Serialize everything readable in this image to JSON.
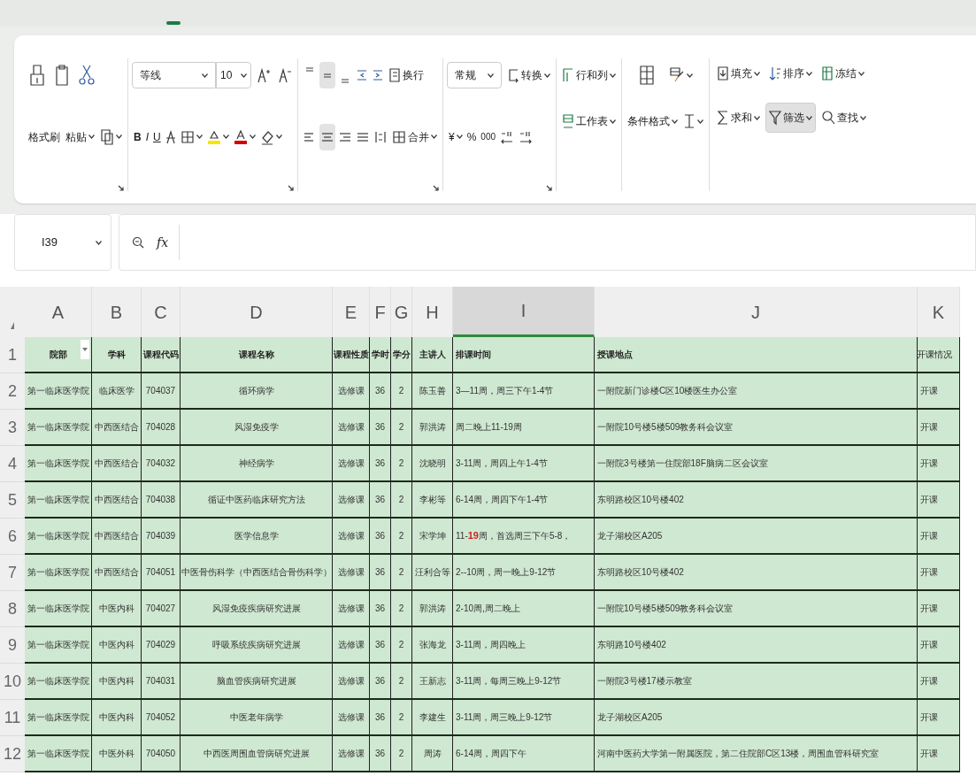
{
  "ribbon": {
    "clipboard": {
      "format_painter": "格式刷",
      "paste": "粘贴"
    },
    "font": {
      "name": "等线",
      "size": "10",
      "styles": [
        "B",
        "I",
        "U"
      ]
    },
    "alignment": {
      "vertical": [
        {
          "selected": false
        },
        {
          "selected": true
        },
        {
          "selected": false
        }
      ],
      "horizontal": [
        {
          "selected": false
        },
        {
          "selected": true
        },
        {
          "selected": false
        },
        {
          "selected": false
        }
      ],
      "wrap": "换行",
      "merge": "合并"
    },
    "number": {
      "format": "常规",
      "convert": "转换",
      "currency": "¥",
      "percent": "%",
      "thousands": "000"
    },
    "cells": {
      "rows_cols": "行和列",
      "sheet": "工作表",
      "cond_format": "条件格式"
    },
    "editing": [
      {
        "label": "填充",
        "pressed": false
      },
      {
        "label": "排序",
        "pressed": false
      },
      {
        "label": "冻结",
        "pressed": false
      },
      {
        "label": "求和",
        "pressed": false
      },
      {
        "label": "筛选",
        "pressed": true
      },
      {
        "label": "查找",
        "pressed": false
      }
    ]
  },
  "formula_bar": {
    "name_box": "I39",
    "function_button": "fx"
  },
  "columns": [
    {
      "letter": "A",
      "selected": false,
      "filter": true
    },
    {
      "letter": "B",
      "selected": false,
      "filter": false
    },
    {
      "letter": "C",
      "selected": false,
      "filter": false
    },
    {
      "letter": "D",
      "selected": false,
      "filter": false
    },
    {
      "letter": "E",
      "selected": false,
      "filter": false
    },
    {
      "letter": "F",
      "selected": false,
      "filter": false
    },
    {
      "letter": "G",
      "selected": false,
      "filter": false
    },
    {
      "letter": "H",
      "selected": false,
      "filter": false
    },
    {
      "letter": "I",
      "selected": true,
      "filter": false
    },
    {
      "letter": "J",
      "selected": false,
      "filter": false
    },
    {
      "letter": "K",
      "selected": false,
      "filter": false
    }
  ],
  "header_row": {
    "number": "1",
    "cells": [
      "院部",
      "学科",
      "课程代码",
      "课程名称",
      "课程性质",
      "学时",
      "学分",
      "主讲人",
      "排课时间",
      "授课地点",
      "开课情况"
    ]
  },
  "rows": [
    {
      "number": "2",
      "cells": [
        "第一临床医学院",
        "临床医学",
        "704037",
        "循环病学",
        "选修课",
        "36",
        "2",
        "陈玉善",
        [
          {
            "text": "3—11周，周三下午1-4节"
          }
        ],
        "一附院新门诊楼C区10楼医生办公室",
        "开课"
      ]
    },
    {
      "number": "3",
      "cells": [
        "第一临床医学院",
        "中西医结合",
        "704028",
        "风湿免疫学",
        "选修课",
        "36",
        "2",
        "郭洪涛",
        [
          {
            "text": "周二晚上11-19周"
          }
        ],
        "一附院10号楼5楼509教务科会议室",
        "开课"
      ]
    },
    {
      "number": "4",
      "cells": [
        "第一临床医学院",
        "中西医结合",
        "704032",
        "神经病学",
        "选修课",
        "36",
        "2",
        "沈晓明",
        [
          {
            "text": "3-11周，周四上午1-4节"
          }
        ],
        "一附院3号楼第一住院部18F脑病二区会议室",
        "开课"
      ]
    },
    {
      "number": "5",
      "cells": [
        "第一临床医学院",
        "中西医结合",
        "704038",
        "循证中医药临床研究方法",
        "选修课",
        "36",
        "2",
        "李彬等",
        [
          {
            "text": "6-14周，周四下午1-4节"
          }
        ],
        "东明路校区10号楼402",
        "开课"
      ]
    },
    {
      "number": "6",
      "cells": [
        "第一临床医学院",
        "中西医结合",
        "704039",
        "医学信息学",
        "选修课",
        "36",
        "2",
        "宋学坤",
        [
          {
            "text": "11-"
          },
          {
            "text": "19",
            "color": "#d42020"
          },
          {
            "text": "周，首选周三下午5-8，"
          }
        ],
        "龙子湖校区A205",
        "开课"
      ]
    },
    {
      "number": "7",
      "cells": [
        "第一临床医学院",
        "中西医结合",
        "704051",
        "中医骨伤科学（中西医结合骨伤科学）",
        "选修课",
        "36",
        "2",
        "汪利合等",
        [
          {
            "text": "2--10周，周一晚上9-12节"
          }
        ],
        "东明路校区10号楼402",
        "开课"
      ]
    },
    {
      "number": "8",
      "cells": [
        "第一临床医学院",
        "中医内科",
        "704027",
        "风湿免疫疾病研究进展",
        "选修课",
        "36",
        "2",
        "郭洪涛",
        [
          {
            "text": "2-10周,周二晚上"
          }
        ],
        "一附院10号楼5楼509教务科会议室",
        "开课"
      ]
    },
    {
      "number": "9",
      "cells": [
        "第一临床医学院",
        "中医内科",
        "704029",
        "呼吸系统疾病研究进展",
        "选修课",
        "36",
        "2",
        "张海龙",
        [
          {
            "text": "3-11周，周四晚上"
          }
        ],
        "东明路10号楼402",
        "开课"
      ]
    },
    {
      "number": "10",
      "cells": [
        "第一临床医学院",
        "中医内科",
        "704031",
        "脑血管疾病研究进展",
        "选修课",
        "36",
        "2",
        "王新志",
        [
          {
            "text": "3-11周，每周三晚上9-12节"
          }
        ],
        "一附院3号楼17楼示教室",
        "开课"
      ]
    },
    {
      "number": "11",
      "cells": [
        "第一临床医学院",
        "中医内科",
        "704052",
        "中医老年病学",
        "选修课",
        "36",
        "2",
        "李建生",
        [
          {
            "text": "3-11周，周三晚上9-12节"
          }
        ],
        "龙子湖校区A205",
        "开课"
      ]
    },
    {
      "number": "12",
      "cells": [
        "第一临床医学院",
        "中医外科",
        "704050",
        "中西医周围血管病研究进展",
        "选修课",
        "36",
        "2",
        "周涛",
        [
          {
            "text": "6-14周，周四下午"
          }
        ],
        "河南中医药大学第一附属医院，第二住院部C区13楼，周围血管科研究室",
        "开课"
      ]
    }
  ]
}
